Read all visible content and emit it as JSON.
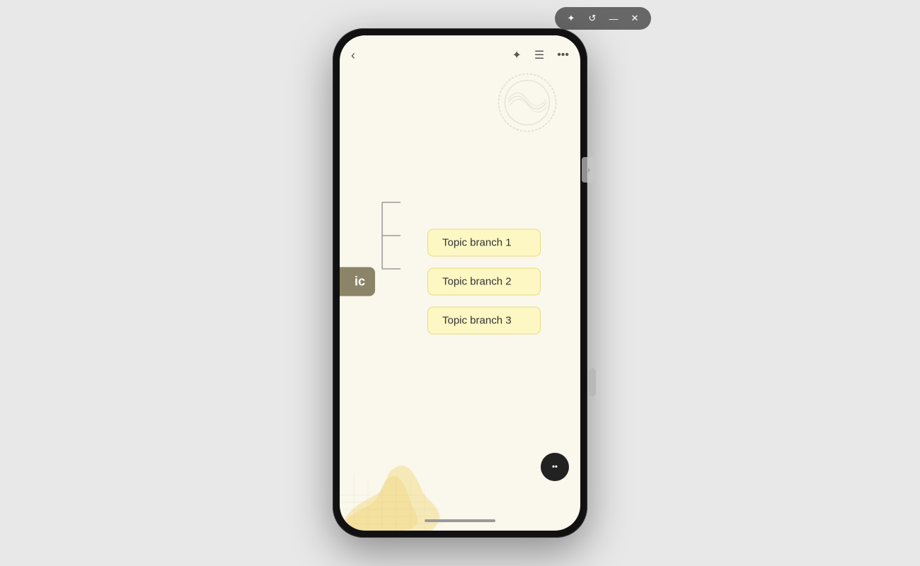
{
  "window": {
    "chrome_buttons": [
      "pin",
      "rotate",
      "minimize",
      "close"
    ]
  },
  "header": {
    "back_label": "‹",
    "pin_icon": "✦",
    "list_icon": "≡",
    "more_icon": "···"
  },
  "root": {
    "label": "ic"
  },
  "branches": [
    {
      "id": 1,
      "label": "Topic branch 1"
    },
    {
      "id": 2,
      "label": "Topic branch 2"
    },
    {
      "id": 3,
      "label": "Topic branch 3"
    }
  ],
  "side_arrow": "›",
  "ai_icon": "••",
  "colors": {
    "background": "#e8e8e8",
    "phone_bg": "#faf8ec",
    "root_bg": "#8b8468",
    "branch_bg": "#fdf7c3",
    "branch_border": "#e8d980",
    "chrome_bg": "rgba(80,80,80,0.85)"
  }
}
